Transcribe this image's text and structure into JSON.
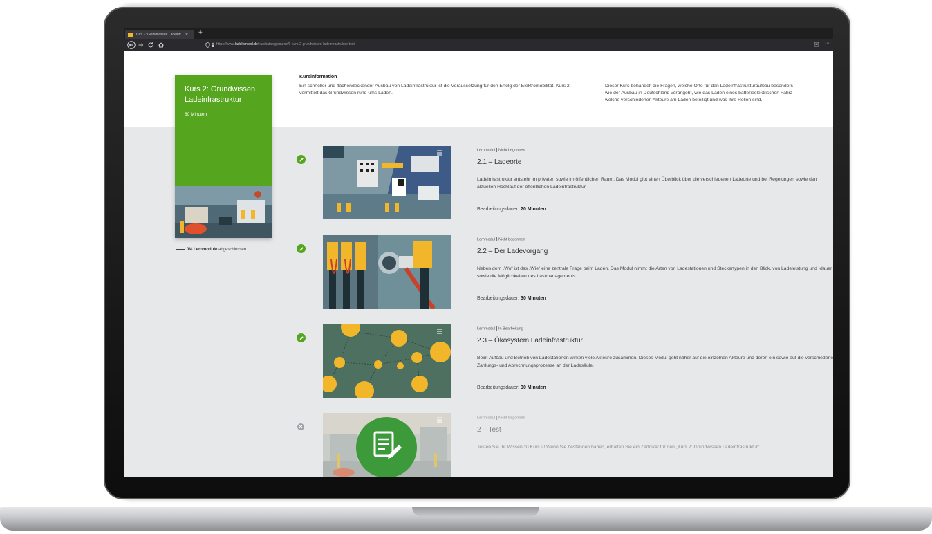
{
  "browser": {
    "tab_title": "Kurs 2: Grundwissen Ladeinfr...",
    "tab_close": "×",
    "new_tab": "+",
    "url_prefix": "https://www.",
    "url_domain": "ladelerntool.de",
    "url_path": "/kurskatalog/course/9-kurs-2-grundwissen-ladeinfrastruktur-test",
    "more_menu": "···"
  },
  "course": {
    "title": "Kurs 2: Grundwissen Ladeinfrastruktur",
    "duration": "80 Minuten",
    "progress_count": "0/4 Lernmodule",
    "progress_suffix": " abgeschlossen"
  },
  "info": {
    "heading": "Kursinformation",
    "text1": "Ein schneller und flächendeckender Ausbau von Ladeinfrastruktur ist die Voraussetzung für den Erfolg der Elektromobilität. Kurs 2 vermittelt das Grundwissen rund ums Laden.",
    "text2_l1": "Dieser Kurs behandelt die Fragen, welche Orte für den Ladeinfrastrukturaufbau besonders",
    "text2_l2": "wie der Ausbau in Deutschland vorangeht, wie das Laden eines batterieelektrischen Fahrz",
    "text2_l3": "welche verschiedenen Akteure am Laden beteiligt und was ihre Rollen sind."
  },
  "modules": [
    {
      "type": "Lernmodul",
      "status": "Nicht begonnen",
      "title": "2.1 – Ladeorte",
      "desc": "Ladeinfrastruktur entsteht im privaten sowie im öffentlichen Raum. Das Modul gibt einen Überblick über die verschiedenen Ladeorte und bel Regelungen sowie den aktuellen Hochlauf der öffentlichen Ladeinfrastruktur.",
      "dur_label": "Bearbeitungsdauer: ",
      "dur_value": "20 Minuten"
    },
    {
      "type": "Lernmodul",
      "status": "Nicht begonnen",
      "title": "2.2 – Der Ladevorgang",
      "desc": "Neben dem „Wo“ ist das „Wie“ eine zentrale Frage beim Laden. Das Modul nimmt die Arten von Ladestationen und Steckertypen in den Blick, von Ladeleistung und -dauer sowie die Möglichkeiten des Lastmanagements.",
      "dur_label": "Bearbeitungsdauer: ",
      "dur_value": "30 Minuten"
    },
    {
      "type": "Lernmodul",
      "status": "In Bearbeitung",
      "title": "2.3 – Ökosystem Ladeinfrastruktur",
      "desc": "Beim Aufbau und Betrieb von Ladestationen wirken viele Akteure zusammen. Dieses Modul geht näher auf die einzelnen Akteure und deren ein sowie auf die verschiedenen Zahlungs- und Abrechnungsprozesse an der Ladesäule.",
      "dur_label": "Bearbeitungsdauer: ",
      "dur_value": "30 Minuten"
    },
    {
      "type": "Lernmodul",
      "status": "Nicht begonnen",
      "title": "2 – Test",
      "desc": "Testen Sie Ihr Wissen zu Kurs 2! Wenn Sie bestanden haben, erhalten Sie ein Zertifikat für den „Kurs 2: Grundwissen Ladeinfrastruktur“."
    }
  ],
  "icons": {
    "complete": "pencil-icon",
    "locked": "x-circle-icon",
    "list": "list-icon"
  },
  "colors": {
    "brand_green": "#56a51e",
    "page_gray": "#e6e8ea",
    "accent_yellow": "#f2b62a"
  }
}
